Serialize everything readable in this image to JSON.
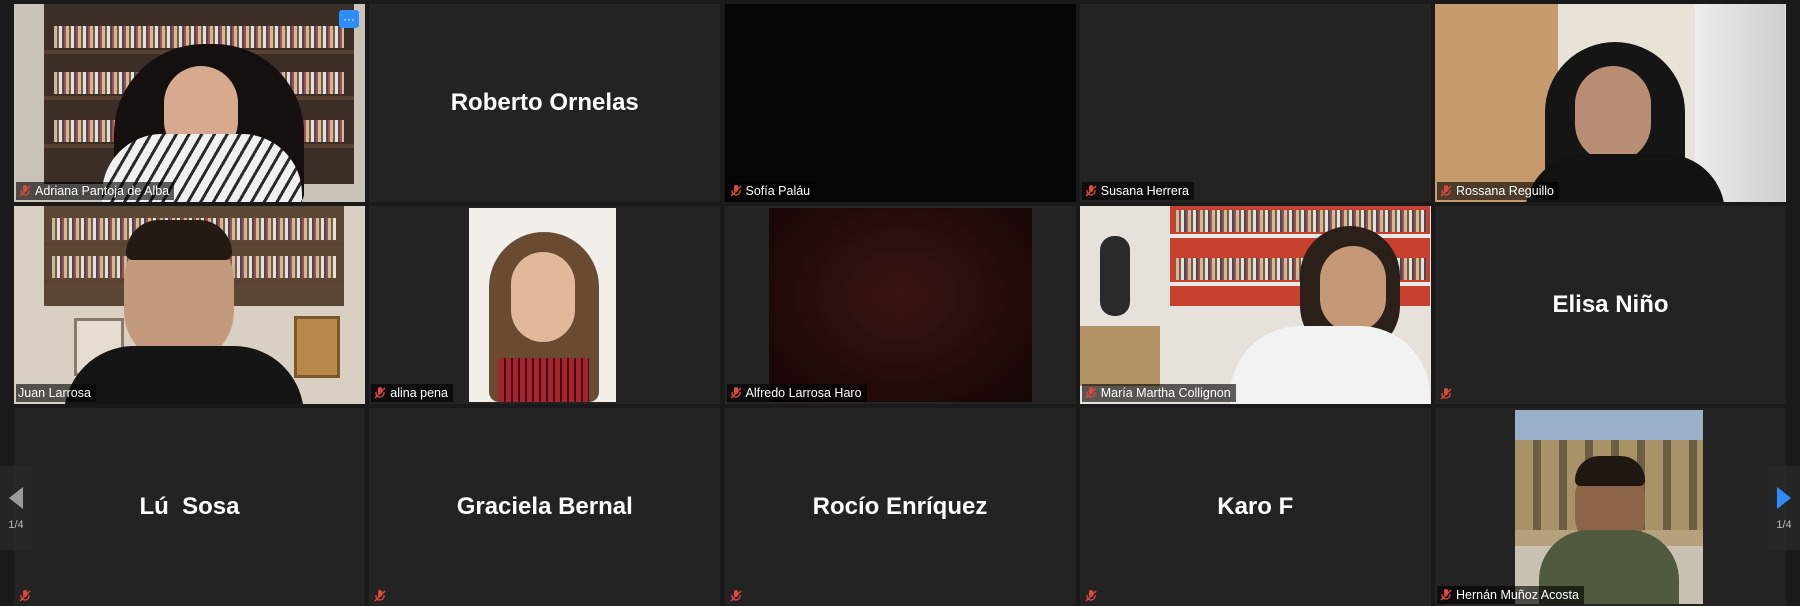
{
  "meeting": {
    "page_indicator": "1/4",
    "tiles": [
      {
        "name": "Adriana Pantoja de Alba",
        "video": true,
        "muted": true
      },
      {
        "name": "Roberto Ornelas",
        "video": false,
        "muted": true,
        "label": false
      },
      {
        "name": "Sofía Paláu",
        "video": true,
        "muted": true
      },
      {
        "name": "Susana Herrera",
        "video": false,
        "muted": true
      },
      {
        "name": "Rossana Reguillo",
        "video": true,
        "muted": true
      },
      {
        "name": "Juan Larrosa",
        "video": true,
        "muted": false,
        "active": true
      },
      {
        "name": "alina pena",
        "video": true,
        "muted": true
      },
      {
        "name": "Alfredo Larrosa Haro",
        "video": true,
        "muted": true
      },
      {
        "name": "María Martha Collignon",
        "video": true,
        "muted": true
      },
      {
        "name": "Elisa Niño",
        "video": false,
        "muted": true
      },
      {
        "name": "Lú  Sosa",
        "video": false,
        "muted": true
      },
      {
        "name": "Graciela Bernal",
        "video": false,
        "muted": true
      },
      {
        "name": "Rocío Enríquez",
        "video": false,
        "muted": true
      },
      {
        "name": "Karo F",
        "video": false,
        "muted": true
      },
      {
        "name": "Hernán Muñoz Acosta",
        "video": true,
        "muted": true
      }
    ]
  },
  "colors": {
    "active_border": "#e8e38c",
    "muted_icon": "#e0483e",
    "more_button": "#2d8cff"
  }
}
